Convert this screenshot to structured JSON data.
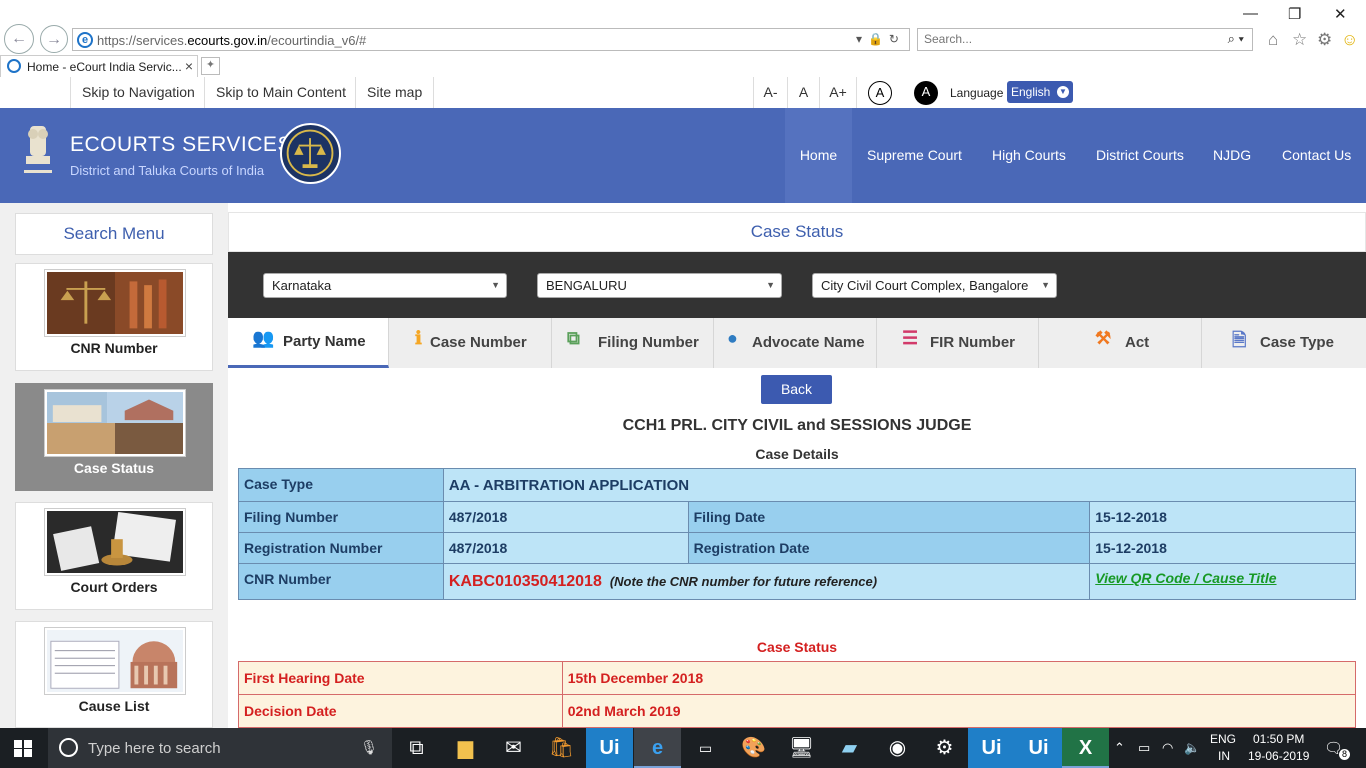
{
  "browser": {
    "url_prefix": "https://services.",
    "url_host": "ecourts.gov.in",
    "url_path": "/ecourtindia_v6/#",
    "search_placeholder": "Search...",
    "tab_title": "Home - eCourt India Servic...",
    "tab_close": "×",
    "back_glyph": "←",
    "forward_glyph": "→",
    "minimize": "—",
    "restore": "❐",
    "close": "✕"
  },
  "accessibility": {
    "skip_nav": "Skip to Navigation",
    "skip_main": "Skip to Main Content",
    "site_map": "Site map",
    "font_small": "A-",
    "font_normal": "A",
    "font_large": "A+",
    "contrast_light": "A",
    "contrast_dark": "A",
    "language_label": "Language",
    "language_value": "English"
  },
  "header": {
    "title": "ECOURTS SERVICES",
    "subtitle": "District and Taluka Courts of India",
    "nav": [
      "Home",
      "Supreme Court",
      "High Courts",
      "District Courts",
      "NJDG",
      "Contact Us"
    ]
  },
  "sidebar": {
    "title": "Search Menu",
    "items": [
      {
        "label": "CNR Number"
      },
      {
        "label": "Case Status"
      },
      {
        "label": "Court Orders"
      },
      {
        "label": "Cause List"
      }
    ]
  },
  "main": {
    "title": "Case Status",
    "state": "Karnataka",
    "district": "BENGALURU",
    "court_complex": "City Civil Court Complex, Bangalore",
    "tabs": [
      {
        "label": "Party Name",
        "icon": "users-icon"
      },
      {
        "label": "Case Number",
        "icon": "info-icon"
      },
      {
        "label": "Filing Number",
        "icon": "copy-icon"
      },
      {
        "label": "Advocate Name",
        "icon": "user-icon"
      },
      {
        "label": "FIR Number",
        "icon": "list-icon"
      },
      {
        "label": "Act",
        "icon": "gavel-icon"
      },
      {
        "label": "Case Type",
        "icon": "document-icon"
      }
    ],
    "back_label": "Back",
    "court_name": "CCH1 PRL. CITY CIVIL and SESSIONS JUDGE",
    "case_details_heading": "Case Details",
    "details": {
      "case_type_label": "Case Type",
      "case_type_value": "AA - ARBITRATION APPLICATION",
      "filing_number_label": "Filing Number",
      "filing_number_value": "487/2018",
      "filing_date_label": "Filing Date",
      "filing_date_value": "15-12-2018",
      "reg_number_label": "Registration Number",
      "reg_number_value": "487/2018",
      "reg_date_label": "Registration Date",
      "reg_date_value": "15-12-2018",
      "cnr_label": "CNR Number",
      "cnr_value": "KABC010350412018",
      "cnr_note": "(Note the CNR number for future reference)",
      "qr_link": "View QR Code / Cause Title"
    },
    "case_status_heading": "Case Status",
    "status": {
      "first_hearing_label": "First Hearing Date",
      "first_hearing_value": "15th December 2018",
      "decision_label": "Decision Date",
      "decision_value": "02nd March 2019"
    }
  },
  "taskbar": {
    "search_placeholder": "Type here to search",
    "lang_top": "ENG",
    "lang_bottom": "IN",
    "time": "01:50 PM",
    "date": "19-06-2019",
    "notifications": "8"
  },
  "colors": {
    "header_blue": "#4a68b7",
    "filter_bar": "#333333",
    "detail_key_bg": "#98cfee",
    "detail_val_bg": "#bde4f7",
    "status_red": "#d42020",
    "qr_green": "#179925"
  }
}
